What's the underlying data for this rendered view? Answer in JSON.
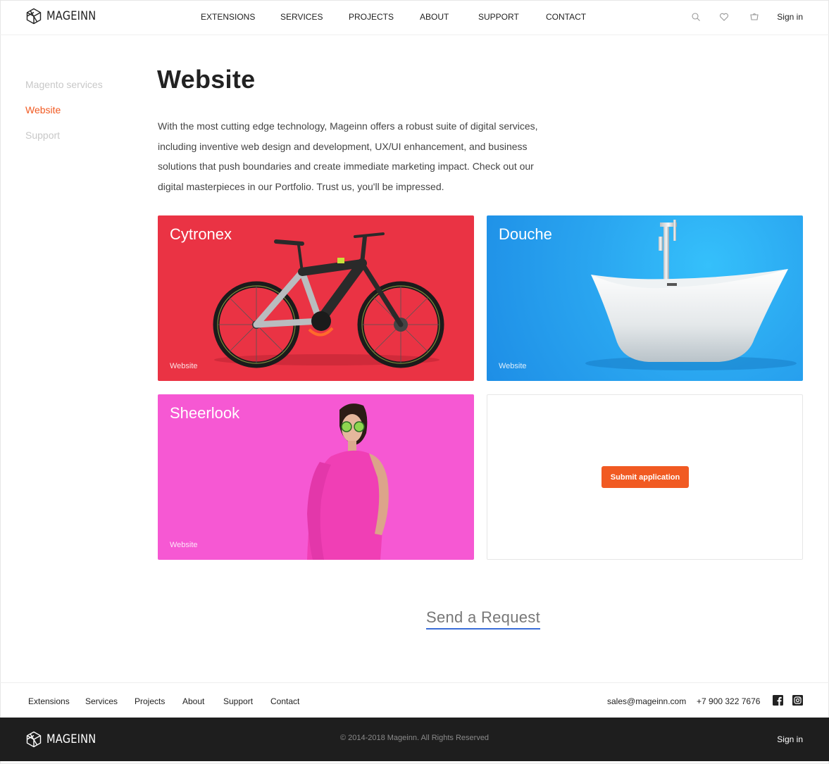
{
  "brand": {
    "name": "MAGEINN"
  },
  "nav": {
    "items": [
      "EXTENSIONS",
      "SERVICES",
      "PROJECTS",
      "ABOUT",
      "SUPPORT",
      "CONTACT"
    ],
    "signin": "Sign in",
    "icons": [
      "search-icon",
      "heart-icon",
      "cart-icon"
    ]
  },
  "sidebar": {
    "items": [
      {
        "label": "Magento services",
        "active": false
      },
      {
        "label": "Website",
        "active": true
      },
      {
        "label": "Support",
        "active": false
      }
    ]
  },
  "main": {
    "title": "Website",
    "intro": "With the most cutting  edge technology, Mageinn offers a robust suite of digital services, including inventive web design and development, UX/UI enhancement, and business solutions that push boundaries and create immediate marketing impact. Check out our digital masterpieces in our Portfolio. Trust us, you'll be impressed.",
    "cards": [
      {
        "title": "Cytronex",
        "tag": "Website",
        "color": "#ea3344"
      },
      {
        "title": "Douche",
        "tag": "Website",
        "color": "#2aa6f0"
      },
      {
        "title": "Sheerlook",
        "tag": "Website",
        "color": "#f658d3"
      }
    ],
    "submit_label": "Submit application",
    "send_request": "Send a Request"
  },
  "footer": {
    "links": [
      "Extensions",
      "Services",
      "Projects",
      "About",
      "Support",
      "Contact"
    ],
    "email": "sales@mageinn.com",
    "phone": "+7 900 322 7676",
    "social": [
      "facebook-icon",
      "instagram-icon"
    ],
    "copyright": "© 2014-2018 Mageinn. All Rights Reserved",
    "signin": "Sign in"
  },
  "colors": {
    "accent": "#f15a22",
    "link_underline": "#3b6ed8",
    "dark_footer": "#1e1e1e"
  }
}
